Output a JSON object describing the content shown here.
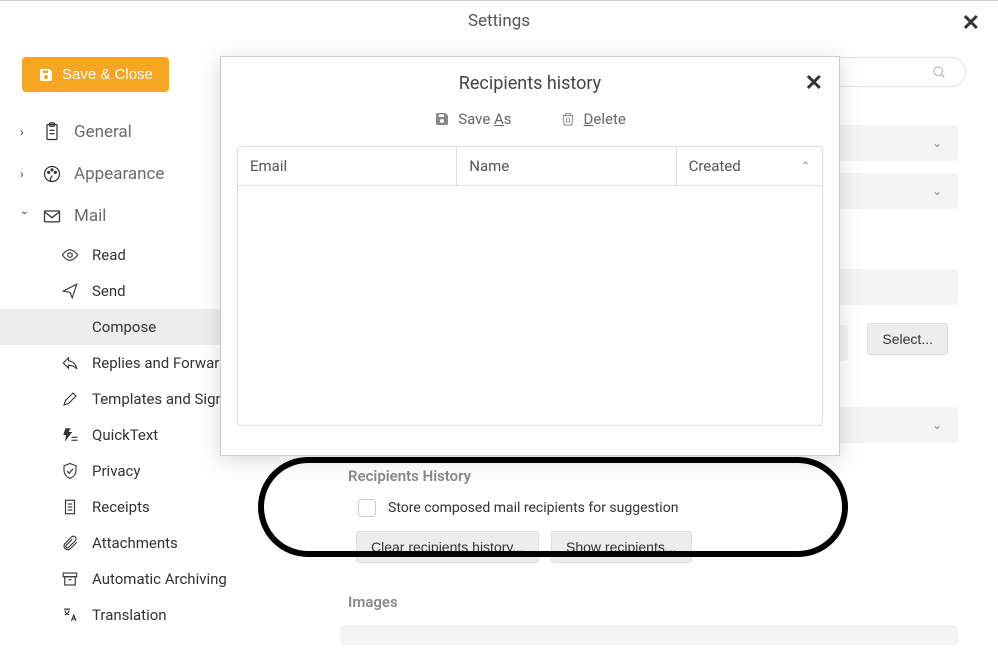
{
  "window": {
    "title": "Settings"
  },
  "saveClose": "Save & Close",
  "search": {
    "placeholder": ""
  },
  "sidebar": {
    "cats": [
      {
        "label": "General",
        "expanded": false
      },
      {
        "label": "Appearance",
        "expanded": false
      },
      {
        "label": "Mail",
        "expanded": true
      }
    ],
    "mailSubs": [
      {
        "label": "Read"
      },
      {
        "label": "Send"
      },
      {
        "label": "Compose"
      },
      {
        "label": "Replies and Forwards"
      },
      {
        "label": "Templates and Signatures"
      },
      {
        "label": "QuickText"
      },
      {
        "label": "Privacy"
      },
      {
        "label": "Receipts"
      },
      {
        "label": "Attachments"
      },
      {
        "label": "Automatic Archiving"
      },
      {
        "label": "Translation"
      }
    ]
  },
  "content": {
    "selectLabel": "Select...",
    "recipientsHistorySection": "Recipients History",
    "storeCheckboxLabel": "Store composed mail recipients for suggestion",
    "clearBtn": "Clear recipients history...",
    "showBtn": "Show recipients...",
    "imagesSection": "Images"
  },
  "modal": {
    "title": "Recipients history",
    "saveAs": {
      "prefix": "Save ",
      "u": "A",
      "suffix": "s"
    },
    "delete": {
      "u": "D",
      "suffix": "elete"
    },
    "cols": {
      "email": "Email",
      "name": "Name",
      "created": "Created"
    }
  }
}
